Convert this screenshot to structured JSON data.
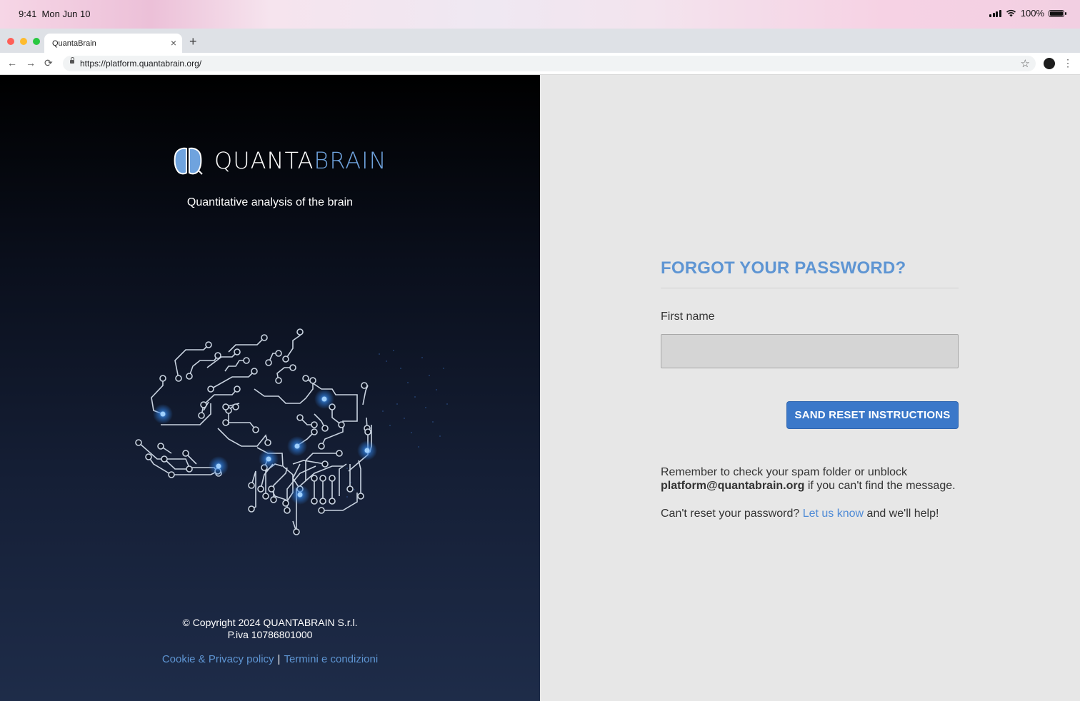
{
  "status_bar": {
    "time": "9:41",
    "date": "Mon Jun 10",
    "battery": "100%"
  },
  "browser": {
    "tab_title": "QuantaBrain",
    "tab_close": "×",
    "new_tab": "+",
    "url": "https://platform.quantabrain.org/",
    "back": "←",
    "forward": "→",
    "reload": "⟳",
    "bookmark": "☆",
    "menu": "⋮"
  },
  "brand": {
    "name_part1": "QUANTA",
    "name_part2": "BRAIN",
    "tagline": "Quantitative analysis of the brain",
    "accent_color": "#6fa3de"
  },
  "footer": {
    "copyright": "© Copyright 2024 QUANTABRAIN S.r.l.",
    "vat": "P.iva 10786801000",
    "cookie_link": "Cookie & Privacy policy",
    "separator": "|",
    "terms_link": "Termini e condizioni"
  },
  "form": {
    "title": "FORGOT YOUR PASSWORD?",
    "field_label": "First name",
    "field_value": "",
    "field_placeholder": "",
    "submit_label": "SAND RESET INSTRUCTIONS",
    "note_line1": "Remember to check your spam folder or unblock",
    "note_email": "platform@quantabrain.org",
    "note_line2_rest": " if you can't find the message.",
    "help_prefix": "Can't reset your password? ",
    "help_link": "Let us know",
    "help_suffix": " and we'll help!",
    "primary_color": "#3b78c9"
  }
}
